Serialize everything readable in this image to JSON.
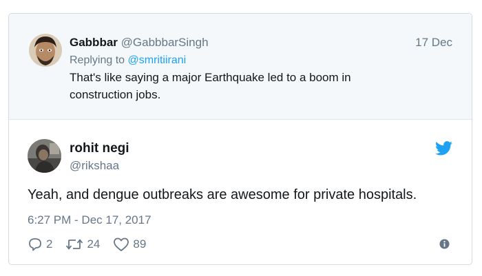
{
  "parent_tweet": {
    "display_name": "Gabbbar",
    "handle": "@GabbbarSingh",
    "date": "17 Dec",
    "replying_prefix": "Replying to",
    "replying_handle": "@smritiirani",
    "text": "That's like saying a major Earthquake led to a boom in construction jobs."
  },
  "main_tweet": {
    "display_name": "rohit negi",
    "handle": "@rikshaa",
    "text": "Yeah, and dengue outbreaks are awesome for private hospitals.",
    "timestamp": "6:27 PM - Dec 17, 2017",
    "reply_count": "2",
    "retweet_count": "24",
    "like_count": "89"
  },
  "icons": {
    "brand": "twitter-bird-icon",
    "reply": "reply-icon",
    "retweet": "retweet-icon",
    "like": "heart-icon",
    "info": "info-icon"
  },
  "colors": {
    "accent": "#1da1f2",
    "muted": "#657786",
    "text": "#14171a",
    "parent_bg": "#f5f8fa"
  }
}
